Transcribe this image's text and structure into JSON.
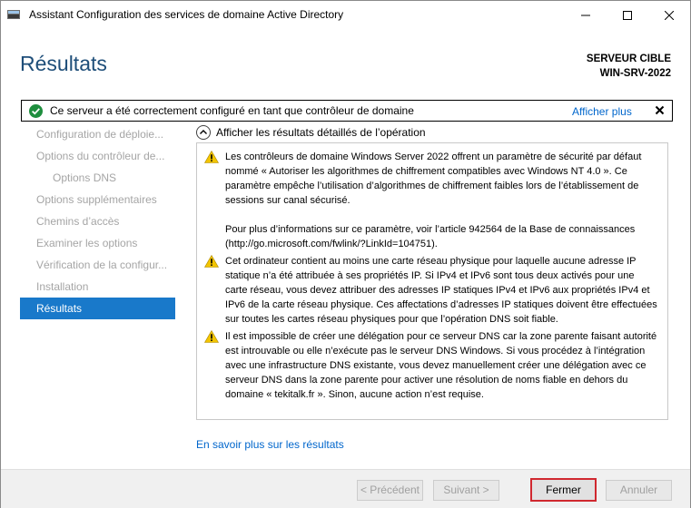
{
  "window": {
    "title": "Assistant Configuration des services de domaine Active Directory"
  },
  "header": {
    "title": "Résultats",
    "server_label": "SERVEUR CIBLE",
    "server_name": "WIN-SRV-2022"
  },
  "banner": {
    "text": "Ce serveur a été correctement configuré en tant que contrôleur de domaine",
    "link": "Afficher plus",
    "status_color": "#1e8e3e"
  },
  "nav": {
    "items": [
      {
        "label": "Configuration de déploie..."
      },
      {
        "label": "Options du contrôleur de..."
      },
      {
        "label": "Options DNS"
      },
      {
        "label": "Options supplémentaires"
      },
      {
        "label": "Chemins d’accès"
      },
      {
        "label": "Examiner les options"
      },
      {
        "label": "Vérification de la configur..."
      },
      {
        "label": "Installation"
      },
      {
        "label": "Résultats"
      }
    ]
  },
  "details": {
    "toggle_label": "Afficher les résultats détaillés de l’opération",
    "messages": [
      {
        "icon": "warning-icon",
        "text": "Les contrôleurs de domaine Windows Server 2022 offrent un paramètre de sécurité par défaut nommé « Autoriser les algorithmes de chiffrement compatibles avec Windows NT 4.0 ». Ce paramètre empêche l’utilisation d’algorithmes de chiffrement faibles lors de l’établissement de sessions sur canal sécurisé.",
        "text2": "Pour plus d’informations sur ce paramètre, voir l’article 942564 de la Base de connaissances (http://go.microsoft.com/fwlink/?LinkId=104751)."
      },
      {
        "icon": "warning-icon",
        "text": "Cet ordinateur contient au moins une carte réseau physique pour laquelle aucune adresse IP statique n’a été attribuée à ses propriétés IP. Si IPv4 et IPv6 sont tous deux activés pour une carte réseau, vous devez attribuer des adresses IP statiques IPv4 et IPv6 aux propriétés IPv4 et IPv6 de la carte réseau physique. Ces affectations d’adresses IP statiques doivent être effectuées sur toutes les cartes réseau physiques pour que l’opération DNS soit fiable."
      },
      {
        "icon": "warning-icon",
        "text": "Il est impossible de créer une délégation pour ce serveur DNS car la zone parente faisant autorité est introuvable ou elle n’exécute pas le serveur DNS Windows. Si vous procédez à l’intégration avec une infrastructure DNS existante, vous devez manuellement créer une délégation avec ce serveur DNS dans la zone parente pour activer une résolution de noms fiable en dehors du domaine « tekitalk.fr ». Sinon, aucune action n’est requise."
      }
    ],
    "learn_more": "En savoir plus sur les résultats"
  },
  "footer": {
    "prev": "< Précédent",
    "next": "Suivant >",
    "close": "Fermer",
    "cancel": "Annuler"
  },
  "colors": {
    "accent": "#1979ca",
    "heading": "#1e4e79",
    "link": "#0066cc",
    "warning": "#f2c400",
    "highlight_border": "#d0282f"
  }
}
